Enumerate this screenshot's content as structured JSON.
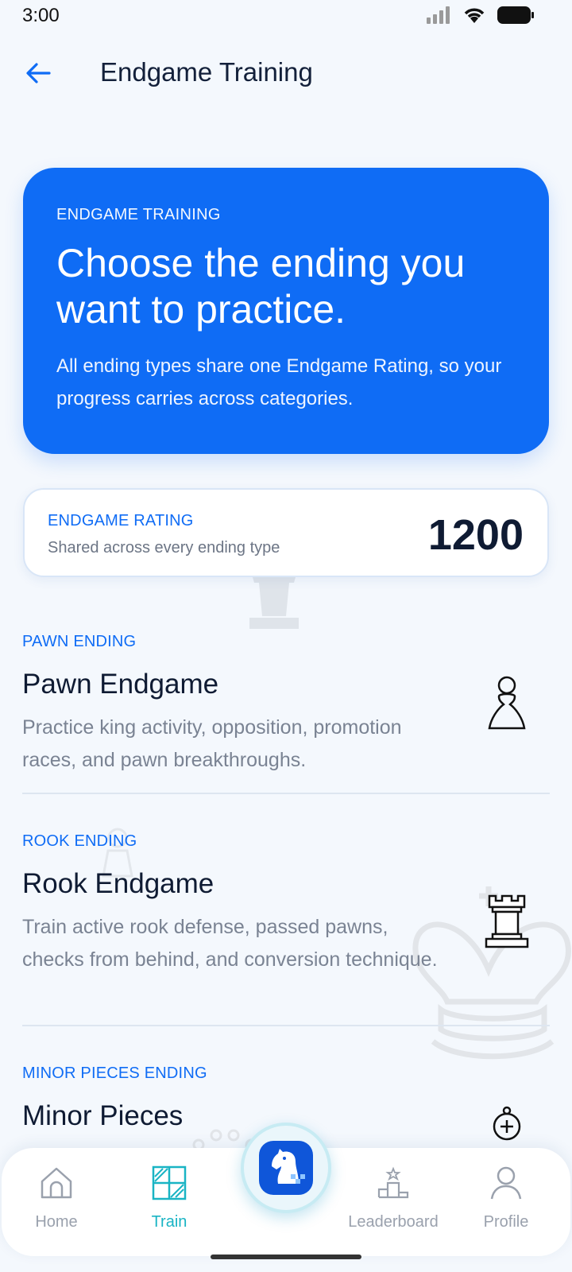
{
  "status_bar": {
    "time": "3:00"
  },
  "header": {
    "title": "Endgame Training"
  },
  "hero": {
    "eyebrow": "ENDGAME TRAINING",
    "title": "Choose the ending you want to practice.",
    "body": "All ending types share one Endgame Rating, so your progress carries across categories."
  },
  "rating": {
    "label": "ENDGAME RATING",
    "subtitle": "Shared across every ending type",
    "value": "1200"
  },
  "endings": [
    {
      "tag": "PAWN ENDING",
      "name": "Pawn Endgame",
      "description": "Practice king activity, opposition, promotion races, and pawn breakthroughs.",
      "icon": "pawn-icon"
    },
    {
      "tag": "ROOK ENDING",
      "name": "Rook Endgame",
      "description": "Train active rook defense, passed pawns, checks from behind, and conversion technique.",
      "icon": "rook-icon"
    },
    {
      "tag": "MINOR PIECES ENDING",
      "name": "Minor Pieces",
      "description": "",
      "icon": "bishop-icon"
    }
  ],
  "nav": {
    "items": [
      {
        "label": "Home",
        "icon": "home-icon"
      },
      {
        "label": "Train",
        "icon": "train-icon",
        "active": true
      },
      {
        "label": "Leaderboard",
        "icon": "leaderboard-icon"
      },
      {
        "label": "Profile",
        "icon": "profile-icon"
      }
    ],
    "center_icon": "knight-icon"
  },
  "colors": {
    "accent": "#0f6cf5",
    "active_nav": "#19b4c4",
    "background": "#f4f8fd"
  }
}
